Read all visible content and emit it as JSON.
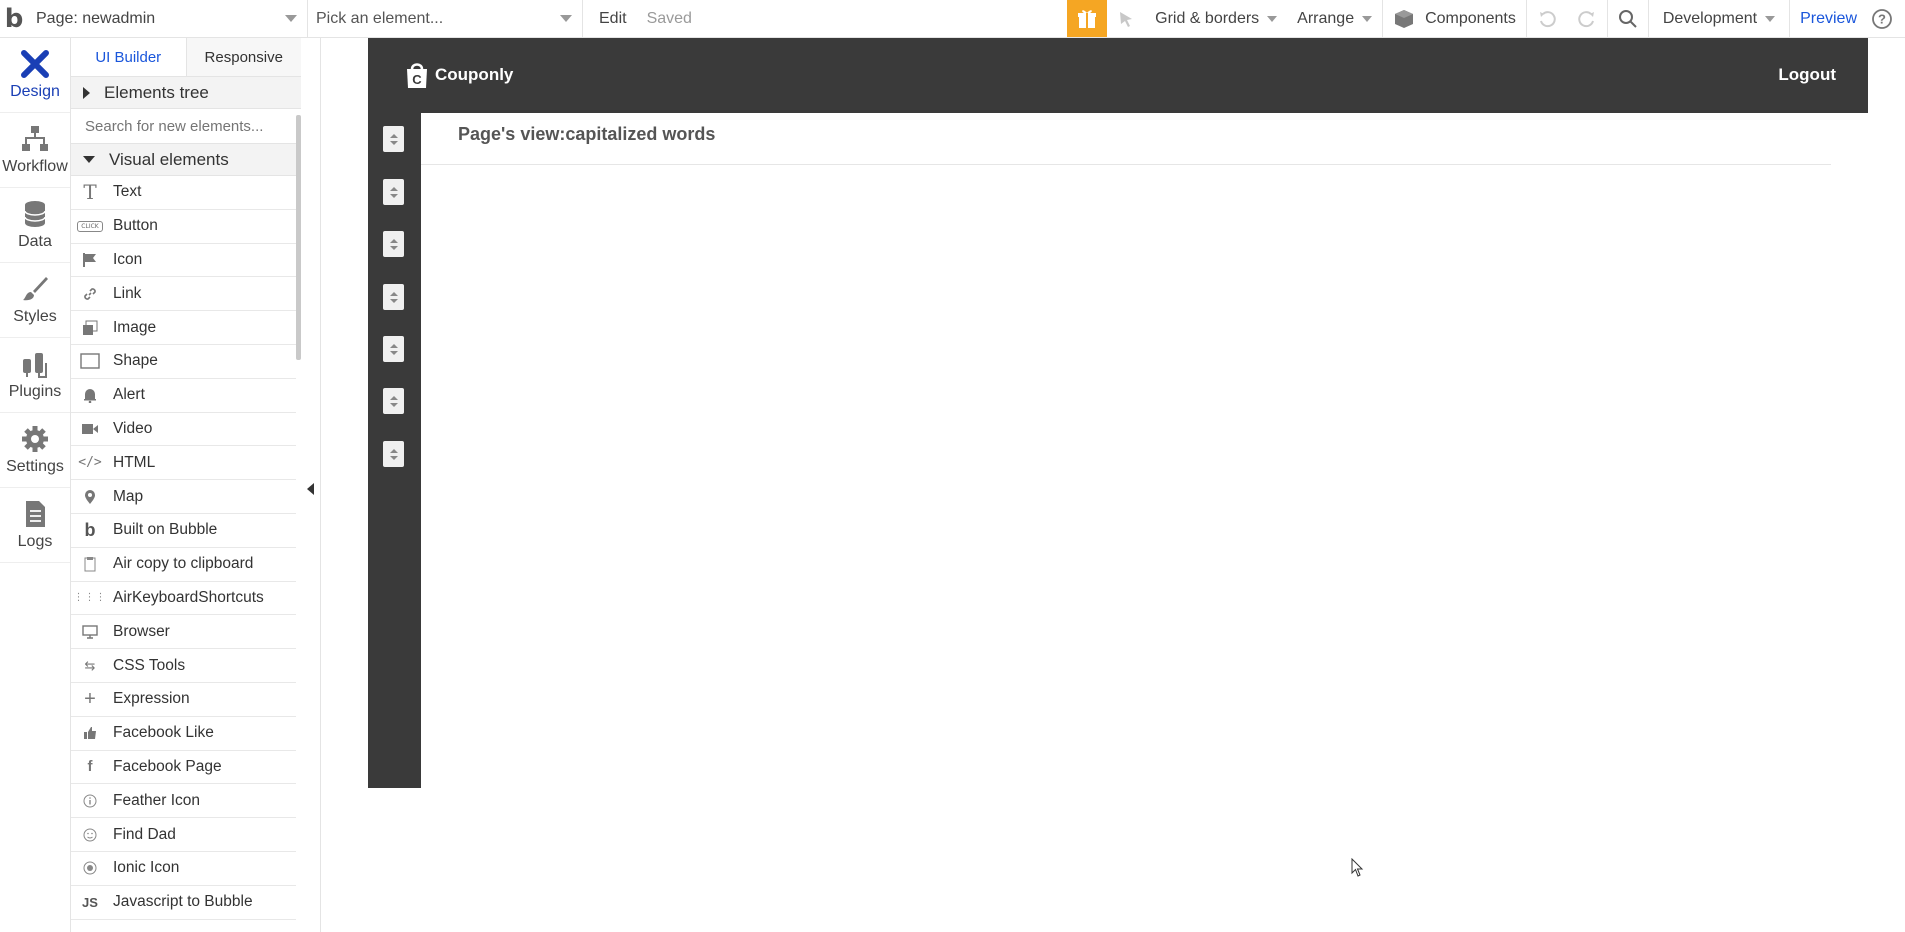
{
  "topbar": {
    "logo": "b",
    "page_select": "Page: newadmin",
    "element_picker": "Pick an element...",
    "edit": "Edit",
    "saved": "Saved",
    "grid_borders": "Grid & borders",
    "arrange": "Arrange",
    "components": "Components",
    "environment": "Development",
    "preview": "Preview"
  },
  "leftnav": [
    {
      "label": "Design",
      "icon": "design-icon"
    },
    {
      "label": "Workflow",
      "icon": "workflow-icon"
    },
    {
      "label": "Data",
      "icon": "database-icon"
    },
    {
      "label": "Styles",
      "icon": "brush-icon"
    },
    {
      "label": "Plugins",
      "icon": "plug-icon"
    },
    {
      "label": "Settings",
      "icon": "gear-icon"
    },
    {
      "label": "Logs",
      "icon": "document-icon"
    }
  ],
  "palette": {
    "tabs": [
      "UI Builder",
      "Responsive"
    ],
    "elements_tree": "Elements tree",
    "search_placeholder": "Search for new elements...",
    "visual_elements": "Visual elements",
    "items": [
      {
        "label": "Text",
        "icon": "text-icon"
      },
      {
        "label": "Button",
        "icon": "button-icon"
      },
      {
        "label": "Icon",
        "icon": "flag-icon"
      },
      {
        "label": "Link",
        "icon": "link-icon"
      },
      {
        "label": "Image",
        "icon": "image-icon"
      },
      {
        "label": "Shape",
        "icon": "shape-icon"
      },
      {
        "label": "Alert",
        "icon": "bell-icon"
      },
      {
        "label": "Video",
        "icon": "video-icon"
      },
      {
        "label": "HTML",
        "icon": "code-icon"
      },
      {
        "label": "Map",
        "icon": "map-pin-icon"
      },
      {
        "label": "Built on Bubble",
        "icon": "bubble-icon"
      },
      {
        "label": "Air copy to clipboard",
        "icon": "clipboard-icon"
      },
      {
        "label": "AirKeyboardShortcuts",
        "icon": "keyboard-icon"
      },
      {
        "label": "Browser",
        "icon": "monitor-icon"
      },
      {
        "label": "CSS Tools",
        "icon": "css-icon"
      },
      {
        "label": "Expression",
        "icon": "plus-icon"
      },
      {
        "label": "Facebook Like",
        "icon": "thumbs-up-icon"
      },
      {
        "label": "Facebook Page",
        "icon": "facebook-icon"
      },
      {
        "label": "Feather Icon",
        "icon": "info-icon"
      },
      {
        "label": "Find Dad",
        "icon": "face-icon"
      },
      {
        "label": "Ionic Icon",
        "icon": "radio-icon"
      },
      {
        "label": "Javascript to Bubble",
        "icon": "js-icon"
      }
    ]
  },
  "app": {
    "brand": "Couponly",
    "logout": "Logout",
    "content_title": "Page's view:capitalized words"
  },
  "colors": {
    "accent": "#1a56db",
    "gift": "#f5a623",
    "app_dark": "#3a3a3a"
  }
}
